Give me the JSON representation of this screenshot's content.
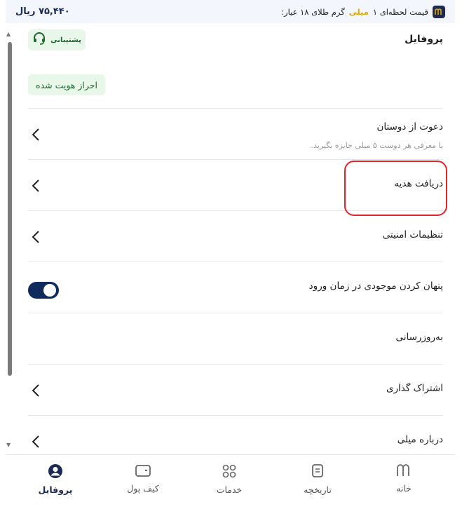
{
  "topbar": {
    "price": "۷۵,۴۴۰ ریال",
    "ticker_prefix": "قیمت لحظه‌ای ۱",
    "ticker_brand": "میلی",
    "ticker_suffix": "گرم طلای ۱۸ عیار:"
  },
  "header": {
    "title": "پروفایل",
    "support_label": "پشتیبانی",
    "verified_badge": "احراز هویت شده"
  },
  "rows": [
    {
      "label": "دعوت از دوستان",
      "subtitle": "با معرفی هر دوست ۵ میلی جایزه بگیرید."
    },
    {
      "label": "دریافت هدیه"
    },
    {
      "label": "تنظیمات امنیتی"
    },
    {
      "label": "پنهان کردن موجودی در زمان ورود",
      "toggle_on": true
    },
    {
      "label": "به‌روزرسانی"
    },
    {
      "label": "اشتراک گذاری"
    },
    {
      "label": "درباره میلی"
    }
  ],
  "nav": {
    "home": "خانه",
    "history": "تاریخچه",
    "services": "خدمات",
    "wallet": "کیف پول",
    "profile": "پروفایل"
  },
  "colors": {
    "accent": "#1d2a55",
    "success_bg": "#e8f7ea",
    "highlight": "#e0262c",
    "brand_gold": "#e0a800"
  }
}
